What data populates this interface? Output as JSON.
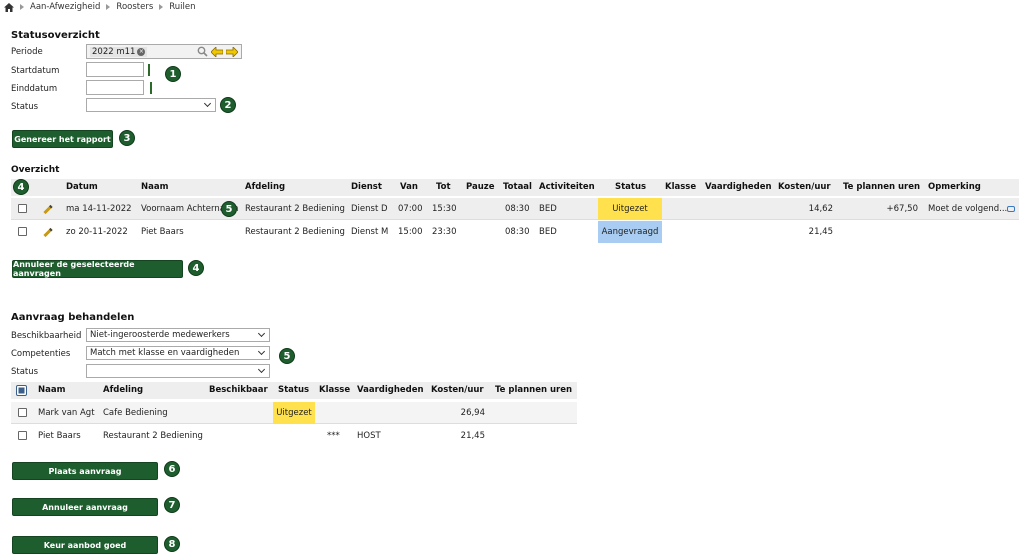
{
  "breadcrumb": [
    "Aan-Afwezigheid",
    "Roosters",
    "Ruilen"
  ],
  "status_overview": {
    "title": "Statusoverzicht",
    "periode_label": "Periode",
    "periode_value": "2022 m11",
    "start_label": "Startdatum",
    "start_value": "",
    "end_label": "Einddatum",
    "end_value": "",
    "status_label": "Status",
    "status_value": ""
  },
  "generate_button": "Genereer het rapport",
  "overview": {
    "title": "Overzicht",
    "headers": [
      "Datum",
      "Naam",
      "Afdeling",
      "Dienst",
      "Van",
      "Tot",
      "Pauze",
      "Totaal",
      "Activiteiten",
      "Status",
      "Klasse",
      "Vaardigheden",
      "Kosten/uur",
      "Te plannen uren",
      "Opmerking"
    ],
    "rows": [
      {
        "datum": "ma 14-11-2022",
        "naam": "Voornaam Achternaam",
        "afdeling": "Restaurant 2 Bediening",
        "dienst": "Dienst D",
        "van": "07:00",
        "tot": "15:30",
        "pauze": "",
        "totaal": "08:30",
        "activiteiten": "BED",
        "status": "Uitgezet",
        "klasse": "",
        "vaardigheden": "",
        "kosten": "14,62",
        "te_plannen": "+67,50",
        "opmerking": "Moet de volgend..."
      },
      {
        "datum": "zo 20-11-2022",
        "naam": "Piet Baars",
        "afdeling": "Restaurant 2 Bediening",
        "dienst": "Dienst M",
        "van": "15:00",
        "tot": "23:30",
        "pauze": "",
        "totaal": "08:30",
        "activiteiten": "BED",
        "status": "Aangevraagd",
        "klasse": "",
        "vaardigheden": "",
        "kosten": "21,45",
        "te_plannen": "",
        "opmerking": ""
      }
    ]
  },
  "cancel_selected_button": "Annuleer de geselecteerde aanvragen",
  "handle_request": {
    "title": "Aanvraag behandelen",
    "beschikbaarheid_label": "Beschikbaarheid",
    "beschikbaarheid_value": "Niet-ingeroosterde medewerkers",
    "competenties_label": "Competenties",
    "competenties_value": "Match met klasse en vaardigheden",
    "status_label": "Status",
    "status_value": "",
    "headers": [
      "Naam",
      "Afdeling",
      "Beschikbaar",
      "Status",
      "Klasse",
      "Vaardigheden",
      "Kosten/uur",
      "Te plannen uren"
    ],
    "rows": [
      {
        "naam": "Mark van Agt",
        "afdeling": "Cafe Bediening",
        "beschikbaar": "",
        "status": "Uitgezet",
        "klasse": "",
        "vaardigheden": "",
        "kosten": "26,94",
        "te_plannen": ""
      },
      {
        "naam": "Piet Baars",
        "afdeling": "Restaurant 2 Bediening",
        "beschikbaar": "",
        "status": "",
        "klasse": "***",
        "vaardigheden": "HOST",
        "kosten": "21,45",
        "te_plannen": ""
      }
    ]
  },
  "buttons": {
    "place": "Plaats aanvraag",
    "cancel": "Annuleer aanvraag",
    "approve": "Keur aanbod goed"
  },
  "badges": [
    "1",
    "2",
    "3",
    "4",
    "5",
    "4",
    "5",
    "6",
    "7",
    "8"
  ],
  "colors": {
    "button": "#1e5e2e",
    "uitgezet": "#ffe14d",
    "aangevraagd": "#a9cdf2"
  }
}
